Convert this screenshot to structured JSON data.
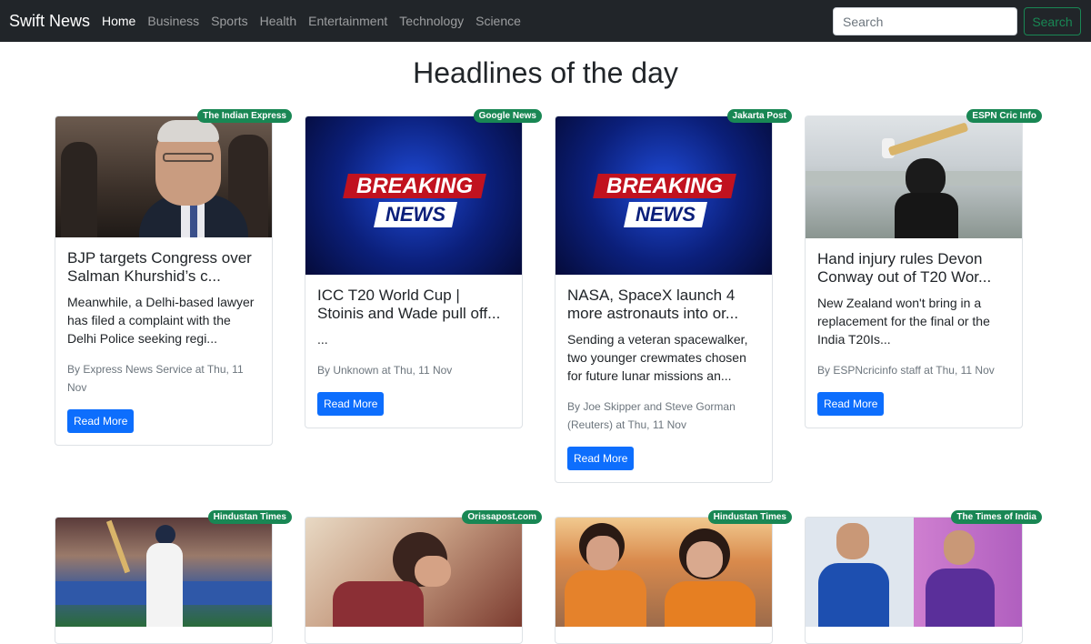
{
  "navbar": {
    "brand": "Swift News",
    "links": [
      {
        "label": "Home",
        "active": true
      },
      {
        "label": "Business",
        "active": false
      },
      {
        "label": "Sports",
        "active": false
      },
      {
        "label": "Health",
        "active": false
      },
      {
        "label": "Entertainment",
        "active": false
      },
      {
        "label": "Technology",
        "active": false
      },
      {
        "label": "Science",
        "active": false
      }
    ],
    "search_placeholder": "Search",
    "search_button": "Search"
  },
  "page": {
    "title": "Headlines of the day"
  },
  "cards": [
    {
      "source": "The Indian Express",
      "title": "BJP targets Congress over Salman Khurshid’s c...",
      "description": "Meanwhile, a Delhi-based lawyer has filed a complaint with the Delhi Police seeking regi...",
      "meta": "By Express News Service at Thu, 11 Nov",
      "button": "Read More",
      "image": "politician-photo"
    },
    {
      "source": "Google News",
      "title": "ICC T20 World Cup | Stoinis and Wade pull off...",
      "description": "...",
      "meta": "By Unknown at Thu, 11 Nov",
      "button": "Read More",
      "image": "breaking-news-graphic",
      "image_text": [
        "BREAKING",
        "NEWS"
      ]
    },
    {
      "source": "Jakarta Post",
      "title": "NASA, SpaceX launch 4 more astronauts into or...",
      "description": "Sending a veteran spacewalker, two younger crewmates chosen for future lunar missions an...",
      "meta": "By Joe Skipper and Steve Gorman (Reuters) at Thu, 11 Nov",
      "button": "Read More",
      "image": "breaking-news-graphic",
      "image_text": [
        "BREAKING",
        "NEWS"
      ]
    },
    {
      "source": "ESPN Cric Info",
      "title": "Hand injury rules Devon Conway out of T20 Wor...",
      "description": "New Zealand won't bring in a replacement for the final or the India T20Is...",
      "meta": "By ESPNcricinfo staff at Thu, 11 Nov",
      "button": "Read More",
      "image": "cricketer-batting-photo"
    },
    {
      "source": "Hindustan Times",
      "image": "cricketer-walking-photo"
    },
    {
      "source": "Orissapost.com",
      "image": "woman-at-laptop-photo"
    },
    {
      "source": "Hindustan Times",
      "image": "rally-women-photo"
    },
    {
      "source": "The Times of India",
      "image": "two-portraits-photo"
    }
  ]
}
